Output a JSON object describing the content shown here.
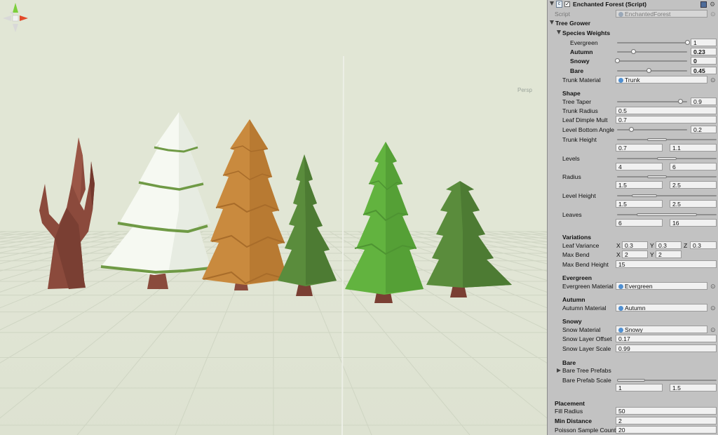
{
  "scene": {
    "gizmo_label": "Persp"
  },
  "inspector": {
    "title": "Enchanted Forest (Script)",
    "script_label": "Script",
    "script_value": "EnchantedForest",
    "tree_grower": "Tree Grower",
    "species_weights": {
      "title": "Species Weights",
      "evergreen": {
        "label": "Evergreen",
        "value": "1",
        "fraction": 1.0
      },
      "autumn": {
        "label": "Autumn",
        "value": "0.23",
        "fraction": 0.23
      },
      "snowy": {
        "label": "Snowy",
        "value": "0",
        "fraction": 0.0
      },
      "bare": {
        "label": "Bare",
        "value": "0.45",
        "fraction": 0.45
      }
    },
    "trunk_material": {
      "label": "Trunk Material",
      "value": "Trunk"
    },
    "shape": {
      "title": "Shape",
      "tree_taper": {
        "label": "Tree Taper",
        "value": "0.9",
        "fraction": 0.9
      },
      "trunk_radius": {
        "label": "Trunk Radius",
        "value": "0.5"
      },
      "leaf_dimple_mult": {
        "label": "Leaf Dimple Mult",
        "value": "0.7"
      },
      "level_bottom_angle": {
        "label": "Level Bottom Angle",
        "value": "0.2",
        "fraction": 0.2
      },
      "trunk_height": {
        "label": "Trunk Height",
        "min": "0.7",
        "max": "1.1",
        "min_frac": 0.3,
        "max_frac": 0.5
      },
      "levels": {
        "label": "Levels",
        "min": "4",
        "max": "6",
        "min_frac": 0.4,
        "max_frac": 0.6
      },
      "radius": {
        "label": "Radius",
        "min": "1.5",
        "max": "2.5",
        "min_frac": 0.3,
        "max_frac": 0.5
      },
      "level_height": {
        "label": "Level Height",
        "min": "1.5",
        "max": "2.5",
        "min_frac": 0.15,
        "max_frac": 0.4
      },
      "leaves": {
        "label": "Leaves",
        "min": "6",
        "max": "16",
        "min_frac": 0.2,
        "max_frac": 0.8
      }
    },
    "variations": {
      "title": "Variations",
      "leaf_variance": {
        "label": "Leaf Variance",
        "x_label": "X",
        "x": "0.3",
        "y_label": "Y",
        "y": "0.3",
        "z_label": "Z",
        "z": "0.3"
      },
      "max_bend": {
        "label": "Max Bend",
        "x_label": "X",
        "x": "2",
        "y_label": "Y",
        "y": "2"
      },
      "max_bend_height": {
        "label": "Max Bend Height",
        "value": "15"
      }
    },
    "evergreen": {
      "title": "Evergreen",
      "label": "Evergreen Material",
      "value": "Evergreen"
    },
    "autumn": {
      "title": "Autumn",
      "label": "Autumn Material",
      "value": "Autumn"
    },
    "snowy": {
      "title": "Snowy",
      "snow_material": {
        "label": "Snow Material",
        "value": "Snowy"
      },
      "snow_layer_offset": {
        "label": "Snow Layer Offset",
        "value": "0.17"
      },
      "snow_layer_scale": {
        "label": "Snow Layer Scale",
        "value": "0.99"
      }
    },
    "bare": {
      "title": "Bare",
      "prefabs_label": "Bare Tree Prefabs",
      "prefab_scale": {
        "label": "Bare Prefab Scale",
        "min": "1",
        "max": "1.5",
        "min_frac": 0.0,
        "max_frac": 0.28
      }
    },
    "placement": {
      "title": "Placement",
      "fill_radius": {
        "label": "Fill Radius",
        "value": "50"
      },
      "min_distance": {
        "label": "Min Distance",
        "value": "2"
      },
      "poisson": {
        "label": "Poisson Sample Count",
        "value": "20"
      }
    }
  },
  "colors": {
    "viewport_bg": "#e0e5d4",
    "inspector_bg": "#c2c2c2",
    "trunk": "#8b4a3c",
    "snow": "#f6f9f2",
    "snow_rim": "#6f9a45",
    "autumn": "#c98a3e",
    "evergreen_dark": "#5a8c3c",
    "evergreen_light": "#62b33f"
  }
}
